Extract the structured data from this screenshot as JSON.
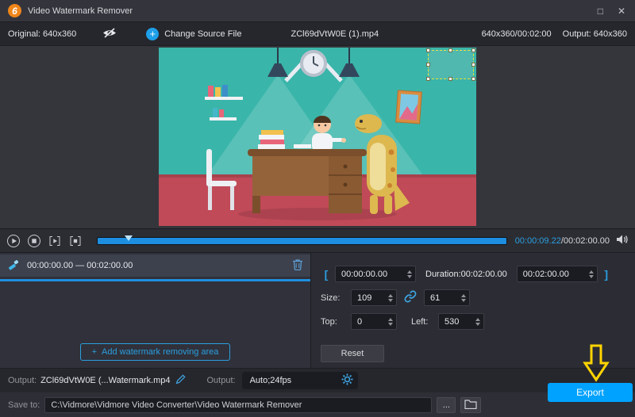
{
  "colors": {
    "accent": "#2a9fe0",
    "export_blue": "#00a2ff",
    "arrow_yellow": "#ffd400",
    "timeline_blue": "#1e8fe0",
    "selection_yellow": "#e8e23c"
  },
  "titlebar": {
    "title": "Video Watermark Remover",
    "logo_glyph": "6",
    "maximize_glyph": "□",
    "close_glyph": "✕"
  },
  "toolbar": {
    "original_label": "Original: 640x360",
    "plus_glyph": "+",
    "change_source_label": "Change Source File",
    "filename": "ZCl69dVtW0E (1).mp4",
    "resolution_duration": "640x360/00:02:00",
    "output_label": "Output: 640x360"
  },
  "player": {
    "current_time": "00:00:09.22",
    "total_time": "/00:02:00.00"
  },
  "watermark_panel": {
    "item_range": "00:00:00.00 — 00:02:00.00",
    "add_plus": "+",
    "add_label": "Add watermark removing area"
  },
  "props": {
    "bracket_open": "[",
    "bracket_close": "]",
    "start_time": "00:00:00.00",
    "duration_label": "Duration:00:02:00.00",
    "end_time": "00:02:00.00",
    "size_label": "Size:",
    "size_width": "109",
    "size_height": "61",
    "top_label": "Top:",
    "top_value": "0",
    "left_label": "Left:",
    "left_value": "530",
    "reset_label": "Reset"
  },
  "output_bar": {
    "output_label": "Output:",
    "output_name": "ZCl69dVtW0E (...Watermark.mp4",
    "format_label": "Output:",
    "format_value": "Auto;24fps",
    "export_label": "Export"
  },
  "save_bar": {
    "label": "Save to:",
    "path": "C:\\Vidmore\\Vidmore Video Converter\\Video Watermark Remover",
    "browse_glyph": "..."
  }
}
